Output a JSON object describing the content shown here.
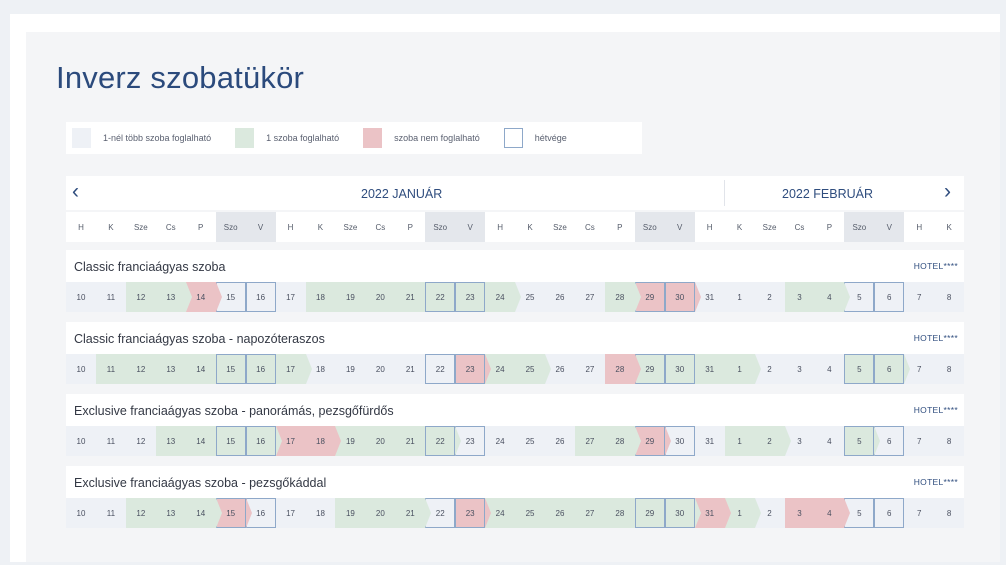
{
  "title": "Inverz szobatükör",
  "legend": [
    {
      "label": "1-nél több szoba foglalható",
      "kind": "many"
    },
    {
      "label": "1 szoba foglalható",
      "kind": "one"
    },
    {
      "label": "szoba nem foglalható",
      "kind": "none"
    },
    {
      "label": "hétvége",
      "kind": "weekend"
    }
  ],
  "calendar": {
    "month1": "2022 JANUÁR",
    "month2": "2022 FEBRUÁR",
    "prev_icon": "‹",
    "next_icon": "›",
    "day_headers": [
      "H",
      "K",
      "Sze",
      "Cs",
      "P",
      "Szo",
      "V",
      "H",
      "K",
      "Sze",
      "Cs",
      "P",
      "Szo",
      "V",
      "H",
      "K",
      "Sze",
      "Cs",
      "P",
      "Szo",
      "V",
      "H",
      "K",
      "Sze",
      "Cs",
      "P",
      "Szo",
      "V",
      "H",
      "K"
    ],
    "dates": [
      "10",
      "11",
      "12",
      "13",
      "14",
      "15",
      "16",
      "17",
      "18",
      "19",
      "20",
      "21",
      "22",
      "23",
      "24",
      "25",
      "26",
      "27",
      "28",
      "29",
      "30",
      "31",
      "1",
      "2",
      "3",
      "4",
      "5",
      "6",
      "7",
      "8"
    ]
  },
  "rooms": [
    {
      "name": "Classic franciaágyas szoba",
      "hotel": "HOTEL****",
      "status": [
        "many",
        "many",
        "one",
        "one",
        "none",
        "many",
        "many",
        "many",
        "one",
        "one",
        "one",
        "one",
        "one",
        "one",
        "one",
        "many",
        "many",
        "many",
        "one",
        "none",
        "none",
        "many",
        "many",
        "many",
        "one",
        "one",
        "many",
        "many",
        "many",
        "many"
      ]
    },
    {
      "name": "Classic franciaágyas szoba - napozóteraszos",
      "hotel": "HOTEL****",
      "status": [
        "many",
        "one",
        "one",
        "one",
        "one",
        "one",
        "one",
        "one",
        "many",
        "many",
        "many",
        "many",
        "many",
        "none",
        "one",
        "one",
        "many",
        "many",
        "none",
        "one",
        "one",
        "one",
        "one",
        "many",
        "many",
        "many",
        "one",
        "one",
        "many",
        "many"
      ]
    },
    {
      "name": "Exclusive franciaágyas szoba - panorámás, pezsgőfürdős",
      "hotel": "HOTEL****",
      "status": [
        "many",
        "many",
        "many",
        "one",
        "one",
        "one",
        "one",
        "none",
        "none",
        "one",
        "one",
        "one",
        "one",
        "many",
        "many",
        "many",
        "many",
        "one",
        "one",
        "none",
        "many",
        "many",
        "one",
        "one",
        "many",
        "many",
        "one",
        "many",
        "many",
        "many"
      ]
    },
    {
      "name": "Exclusive franciaágyas szoba - pezsgőkáddal",
      "hotel": "HOTEL****",
      "status": [
        "many",
        "many",
        "one",
        "one",
        "one",
        "none",
        "many",
        "many",
        "many",
        "one",
        "one",
        "one",
        "many",
        "none",
        "one",
        "one",
        "one",
        "one",
        "one",
        "one",
        "one",
        "none",
        "one",
        "many",
        "none",
        "none",
        "many",
        "many",
        "many",
        "many"
      ]
    }
  ]
}
